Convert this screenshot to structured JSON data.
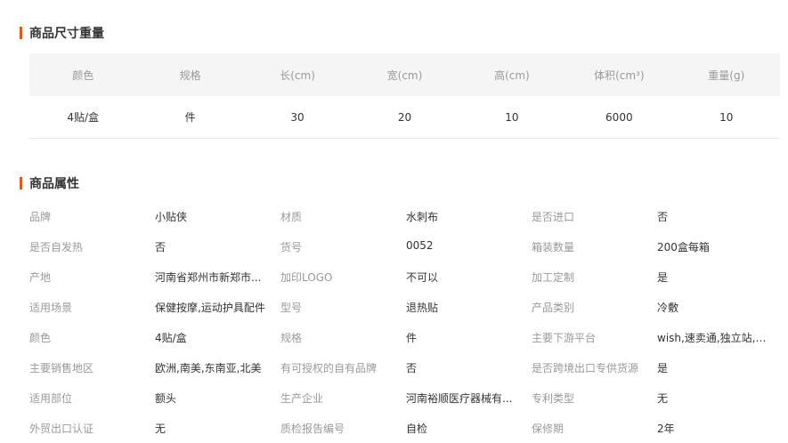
{
  "size_section": {
    "title": "商品尺寸重量",
    "headers": [
      "颜色",
      "规格",
      "长(cm)",
      "宽(cm)",
      "高(cm)",
      "体积(cm³)",
      "重量(g)"
    ],
    "rows": [
      [
        "4贴/盒",
        "件",
        "30",
        "20",
        "10",
        "6000",
        "10"
      ]
    ]
  },
  "attr_section": {
    "title": "商品属性",
    "rows": [
      [
        {
          "k": "品牌",
          "v": "小贴侠"
        },
        {
          "k": "材质",
          "v": "水刺布"
        },
        {
          "k": "是否进口",
          "v": "否"
        }
      ],
      [
        {
          "k": "是否自发热",
          "v": "否"
        },
        {
          "k": "货号",
          "v": "0052"
        },
        {
          "k": "箱装数量",
          "v": "200盒每箱"
        }
      ],
      [
        {
          "k": "产地",
          "v": "河南省郑州市新郑市..."
        },
        {
          "k": "加印LOGO",
          "v": "不可以"
        },
        {
          "k": "加工定制",
          "v": "是"
        }
      ],
      [
        {
          "k": "适用场景",
          "v": "保健按摩,运动护具配件"
        },
        {
          "k": "型号",
          "v": "退热贴"
        },
        {
          "k": "产品类别",
          "v": "冷敷"
        }
      ],
      [
        {
          "k": "颜色",
          "v": "4贴/盒"
        },
        {
          "k": "规格",
          "v": "件"
        },
        {
          "k": "主要下游平台",
          "v": "wish,速卖通,独立站,L..."
        }
      ],
      [
        {
          "k": "主要销售地区",
          "v": "欧洲,南美,东南亚,北美"
        },
        {
          "k": "有可授权的自有品牌",
          "v": "否"
        },
        {
          "k": "是否跨境出口专供货源",
          "v": "是"
        }
      ],
      [
        {
          "k": "适用部位",
          "v": "额头"
        },
        {
          "k": "生产企业",
          "v": "河南裕顺医疗器械有..."
        },
        {
          "k": "专利类型",
          "v": "无"
        }
      ],
      [
        {
          "k": "外贸出口认证",
          "v": "无"
        },
        {
          "k": "质检报告编号",
          "v": "自检"
        },
        {
          "k": "保修期",
          "v": "2年"
        }
      ]
    ]
  }
}
